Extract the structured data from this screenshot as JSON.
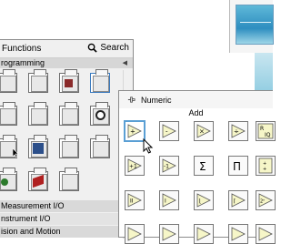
{
  "functions_palette": {
    "title": "Functions",
    "search_label": "Search",
    "current_category": "rogramming",
    "categories": [
      "Measurement I/O",
      "nstrument I/O",
      "ision and Motion"
    ]
  },
  "numeric_palette": {
    "title": "Numeric",
    "selected_item": "Add",
    "icon_rows": [
      [
        "add",
        "subtract",
        "multiply",
        "divide",
        "quotient-remainder"
      ],
      [
        "increment",
        "decrement",
        "add-array-elements",
        "multiply-array-elements",
        "compound-arithmetic"
      ],
      [
        "absolute-value",
        "round-to-nearest",
        "round-toward-neg-inf",
        "round-toward-pos-inf",
        "scale-by-power-of-2"
      ],
      [
        "square-root",
        "square",
        "negate",
        "reciprocal",
        "sign"
      ]
    ]
  }
}
